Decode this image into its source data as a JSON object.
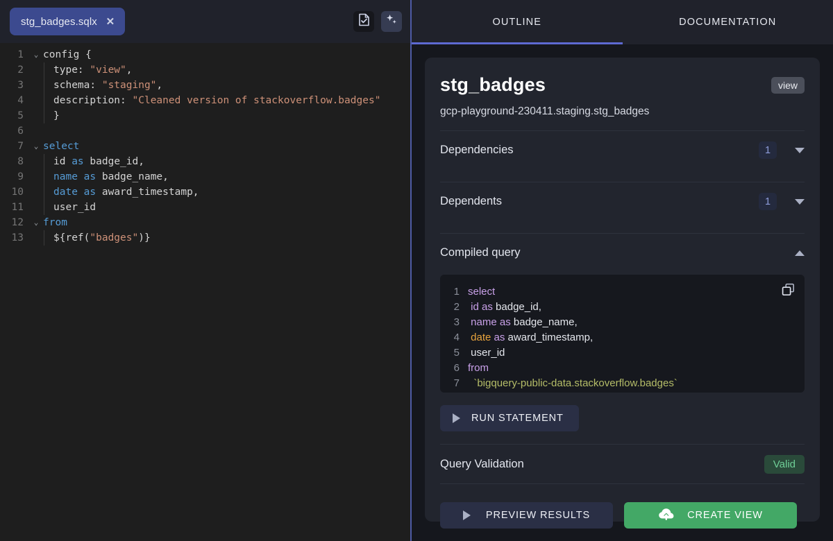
{
  "editor": {
    "tab": {
      "label": "stg_badges.sqlx",
      "close_icon": "close-icon"
    },
    "toolbar": {
      "compile_icon": "document-check-icon",
      "assist_icon": "sparkles-icon"
    },
    "lines": [
      {
        "n": "1",
        "fold": "⌄",
        "indent": 0,
        "tokens": [
          {
            "t": "config ",
            "c": "p"
          },
          {
            "t": "{",
            "c": "p"
          }
        ]
      },
      {
        "n": "2",
        "fold": "",
        "indent": 1,
        "tokens": [
          {
            "t": "type: ",
            "c": "p"
          },
          {
            "t": "\"view\"",
            "c": "s"
          },
          {
            "t": ",",
            "c": "p"
          }
        ]
      },
      {
        "n": "3",
        "fold": "",
        "indent": 1,
        "tokens": [
          {
            "t": "schema: ",
            "c": "p"
          },
          {
            "t": "\"staging\"",
            "c": "s"
          },
          {
            "t": ",",
            "c": "p"
          }
        ]
      },
      {
        "n": "4",
        "fold": "",
        "indent": 1,
        "tokens": [
          {
            "t": "description: ",
            "c": "p"
          },
          {
            "t": "\"Cleaned version of stackoverflow.badges\"",
            "c": "s"
          }
        ]
      },
      {
        "n": "5",
        "fold": "",
        "indent": 1,
        "tokens": [
          {
            "t": "}",
            "c": "p"
          }
        ]
      },
      {
        "n": "6",
        "fold": "",
        "indent": 0,
        "tokens": []
      },
      {
        "n": "7",
        "fold": "⌄",
        "indent": 0,
        "tokens": [
          {
            "t": "select",
            "c": "k"
          }
        ]
      },
      {
        "n": "8",
        "fold": "",
        "indent": 1,
        "tokens": [
          {
            "t": "id ",
            "c": "p"
          },
          {
            "t": "as",
            "c": "k"
          },
          {
            "t": " badge_id,",
            "c": "p"
          }
        ]
      },
      {
        "n": "9",
        "fold": "",
        "indent": 1,
        "tokens": [
          {
            "t": "name",
            "c": "k"
          },
          {
            "t": " ",
            "c": "p"
          },
          {
            "t": "as",
            "c": "k"
          },
          {
            "t": " badge_name,",
            "c": "p"
          }
        ]
      },
      {
        "n": "10",
        "fold": "",
        "indent": 1,
        "tokens": [
          {
            "t": "date",
            "c": "k"
          },
          {
            "t": " ",
            "c": "p"
          },
          {
            "t": "as",
            "c": "k"
          },
          {
            "t": " award_timestamp,",
            "c": "p"
          }
        ]
      },
      {
        "n": "11",
        "fold": "",
        "indent": 1,
        "tokens": [
          {
            "t": "user_id",
            "c": "p"
          }
        ]
      },
      {
        "n": "12",
        "fold": "⌄",
        "indent": 0,
        "tokens": [
          {
            "t": "from",
            "c": "k"
          }
        ]
      },
      {
        "n": "13",
        "fold": "",
        "indent": 1,
        "tokens": [
          {
            "t": "${ref(",
            "c": "p"
          },
          {
            "t": "\"badges\"",
            "c": "s"
          },
          {
            "t": ")}",
            "c": "p"
          }
        ]
      }
    ]
  },
  "panel": {
    "tabs": [
      {
        "label": "OUTLINE",
        "active": true
      },
      {
        "label": "DOCUMENTATION",
        "active": false
      }
    ],
    "outline": {
      "title": "stg_badges",
      "type_badge": "view",
      "fully_qualified_name": "gcp-playground-230411.staging.stg_badges",
      "sections": [
        {
          "label": "Dependencies",
          "count": "1",
          "caret": "chevron-down-icon",
          "expanded": false
        },
        {
          "label": "Dependents",
          "count": "1",
          "caret": "chevron-down-icon",
          "expanded": false
        }
      ],
      "compiled_query": {
        "label": "Compiled query",
        "caret": "chevron-up-icon",
        "expanded": true,
        "copy_icon": "copy-icon",
        "lines": [
          {
            "n": "1",
            "tokens": [
              {
                "t": "select",
                "c": "qk"
              }
            ]
          },
          {
            "n": "2",
            "tokens": [
              {
                "t": " ",
                "c": "qp"
              },
              {
                "t": "id",
                "c": "qk"
              },
              {
                "t": " ",
                "c": "qp"
              },
              {
                "t": "as",
                "c": "qk"
              },
              {
                "t": " badge_id,",
                "c": "qp"
              }
            ]
          },
          {
            "n": "3",
            "tokens": [
              {
                "t": " ",
                "c": "qp"
              },
              {
                "t": "name",
                "c": "qk"
              },
              {
                "t": " ",
                "c": "qp"
              },
              {
                "t": "as",
                "c": "qk"
              },
              {
                "t": " badge_name,",
                "c": "qp"
              }
            ]
          },
          {
            "n": "4",
            "tokens": [
              {
                "t": " ",
                "c": "qp"
              },
              {
                "t": "date",
                "c": "qd"
              },
              {
                "t": " ",
                "c": "qp"
              },
              {
                "t": "as",
                "c": "qk"
              },
              {
                "t": " award_timestamp,",
                "c": "qp"
              }
            ]
          },
          {
            "n": "5",
            "tokens": [
              {
                "t": " user_id",
                "c": "qp"
              }
            ]
          },
          {
            "n": "6",
            "tokens": [
              {
                "t": "from",
                "c": "qk"
              }
            ]
          },
          {
            "n": "7",
            "tokens": [
              {
                "t": "  `bigquery-public-data.stackoverflow.badges`",
                "c": "qt"
              }
            ]
          }
        ]
      },
      "run_statement_button": {
        "label": "RUN STATEMENT",
        "icon": "play-icon"
      },
      "validation": {
        "label": "Query Validation",
        "status": "Valid"
      },
      "actions": [
        {
          "label": "PREVIEW RESULTS",
          "icon": "play-icon",
          "style": "secondary"
        },
        {
          "label": "CREATE VIEW",
          "icon": "cloud-upload-icon",
          "style": "primary"
        }
      ]
    }
  },
  "colors": {
    "accent": "#5e6ad2",
    "tab_active": "#3c4a8f",
    "primary_button": "#43a866",
    "valid_text": "#6fcf97",
    "editor_bg": "#1e1e1e",
    "panel_bg": "#15171d",
    "card_bg": "#22252e"
  }
}
